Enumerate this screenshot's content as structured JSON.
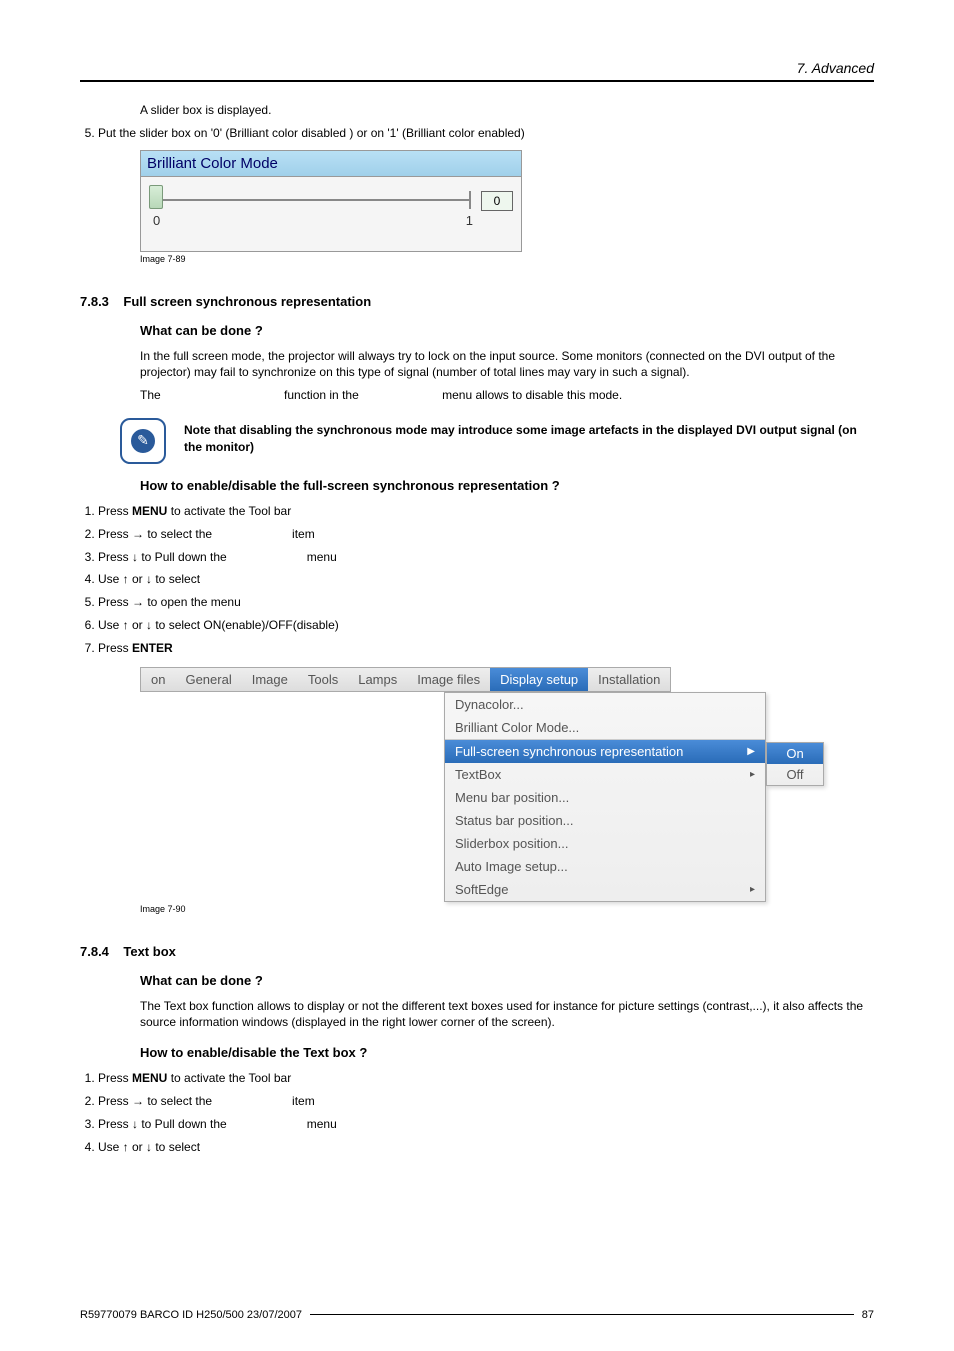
{
  "header": {
    "chapter": "7. Advanced"
  },
  "intro": {
    "line1": "A slider box is displayed.",
    "step5": "Put the slider box on '0' (Brilliant color disabled ) or on '1' (Brilliant color enabled)"
  },
  "slider": {
    "title": "Brilliant Color Mode",
    "min": "0",
    "max": "1",
    "value": "0",
    "caption": "Image 7-89"
  },
  "sec783": {
    "num": "7.8.3",
    "title": "Full screen synchronous representation",
    "whathead": "What can be done ?",
    "whatp1": "In the full screen mode, the projector will always try to lock on the input source. Some monitors (connected on the DVI output of the projector) may fail to synchronize on this type of signal (number of total lines may vary in such a signal).",
    "thep_a": "The",
    "thep_b": "function in the",
    "thep_c": "menu allows to disable this mode.",
    "note": "Note that disabling the synchronous mode may introduce some image artefacts in the displayed DVI output signal (on the monitor)",
    "howhead": "How to enable/disable the full-screen synchronous representation ?",
    "steps": {
      "s1a": "Press ",
      "s1b": "MENU",
      "s1c": " to activate the Tool bar",
      "s2a": "Press → to select the",
      "s2b": "item",
      "s3a": "Press ↓ to Pull down the",
      "s3b": "menu",
      "s4": "Use ↑ or ↓ to select",
      "s5": "Press → to open the menu",
      "s6": "Use ↑ or ↓ to select ON(enable)/OFF(disable)",
      "s7a": "Press ",
      "s7b": "ENTER"
    },
    "caption": "Image 7-90"
  },
  "menubar": {
    "items": [
      "on",
      "General",
      "Image",
      "Tools",
      "Lamps",
      "Image files",
      "Display setup",
      "Installation"
    ],
    "selectedIndex": 6
  },
  "dropdown": {
    "topItems": [
      "Dynacolor...",
      "Brilliant Color Mode..."
    ],
    "selected": "Full-screen synchronous representation",
    "rest": [
      {
        "label": "TextBox",
        "arrow": true
      },
      {
        "label": "Menu bar position...",
        "arrow": false
      },
      {
        "label": "Status bar position...",
        "arrow": false
      },
      {
        "label": "Sliderbox position...",
        "arrow": false
      },
      {
        "label": "Auto Image setup...",
        "arrow": false
      },
      {
        "label": "SoftEdge",
        "arrow": true
      }
    ]
  },
  "submenu": {
    "on": "On",
    "off": "Off"
  },
  "sec784": {
    "num": "7.8.4",
    "title": "Text box",
    "whathead": "What can be done ?",
    "whatp": "The Text box function allows to display or not the different text boxes used for instance for picture settings (contrast,...), it also affects the source information windows (displayed in the right lower corner of the screen).",
    "howhead": "How to enable/disable the Text box ?",
    "steps": {
      "s1a": "Press ",
      "s1b": "MENU",
      "s1c": " to activate the Tool bar",
      "s2a": "Press → to select the",
      "s2b": "item",
      "s3a": "Press ↓ to Pull down the",
      "s3b": "menu",
      "s4": "Use ↑ or ↓ to select"
    }
  },
  "footer": {
    "left": "R59770079  BARCO ID H250/500  23/07/2007",
    "right": "87"
  }
}
